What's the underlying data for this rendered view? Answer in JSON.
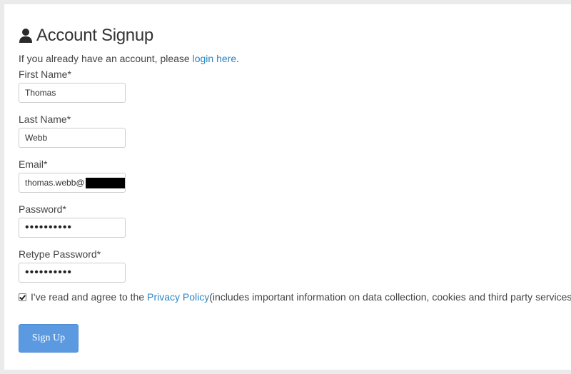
{
  "title": "Account Signup",
  "intro": {
    "text": "If you already have an account, please ",
    "link": "login here",
    "after": "."
  },
  "fields": {
    "first_name": {
      "label": "First Name*",
      "value": "Thomas"
    },
    "last_name": {
      "label": "Last Name*",
      "value": "Webb"
    },
    "email": {
      "label": "Email*",
      "value": "thomas.webb@"
    },
    "password": {
      "label": "Password*",
      "value": "••••••••••"
    },
    "retype": {
      "label": "Retype Password*",
      "value": "••••••••••"
    }
  },
  "agree": {
    "prefix": "I've read and agree to the ",
    "link": "Privacy Policy",
    "suffix": " (includes important information on data collection, cookies and third party services)",
    "checked": true
  },
  "submit_label": "Sign Up",
  "colors": {
    "link": "#2a86c7",
    "button": "#5b9ae0"
  },
  "icons": {
    "title": "user-icon"
  }
}
